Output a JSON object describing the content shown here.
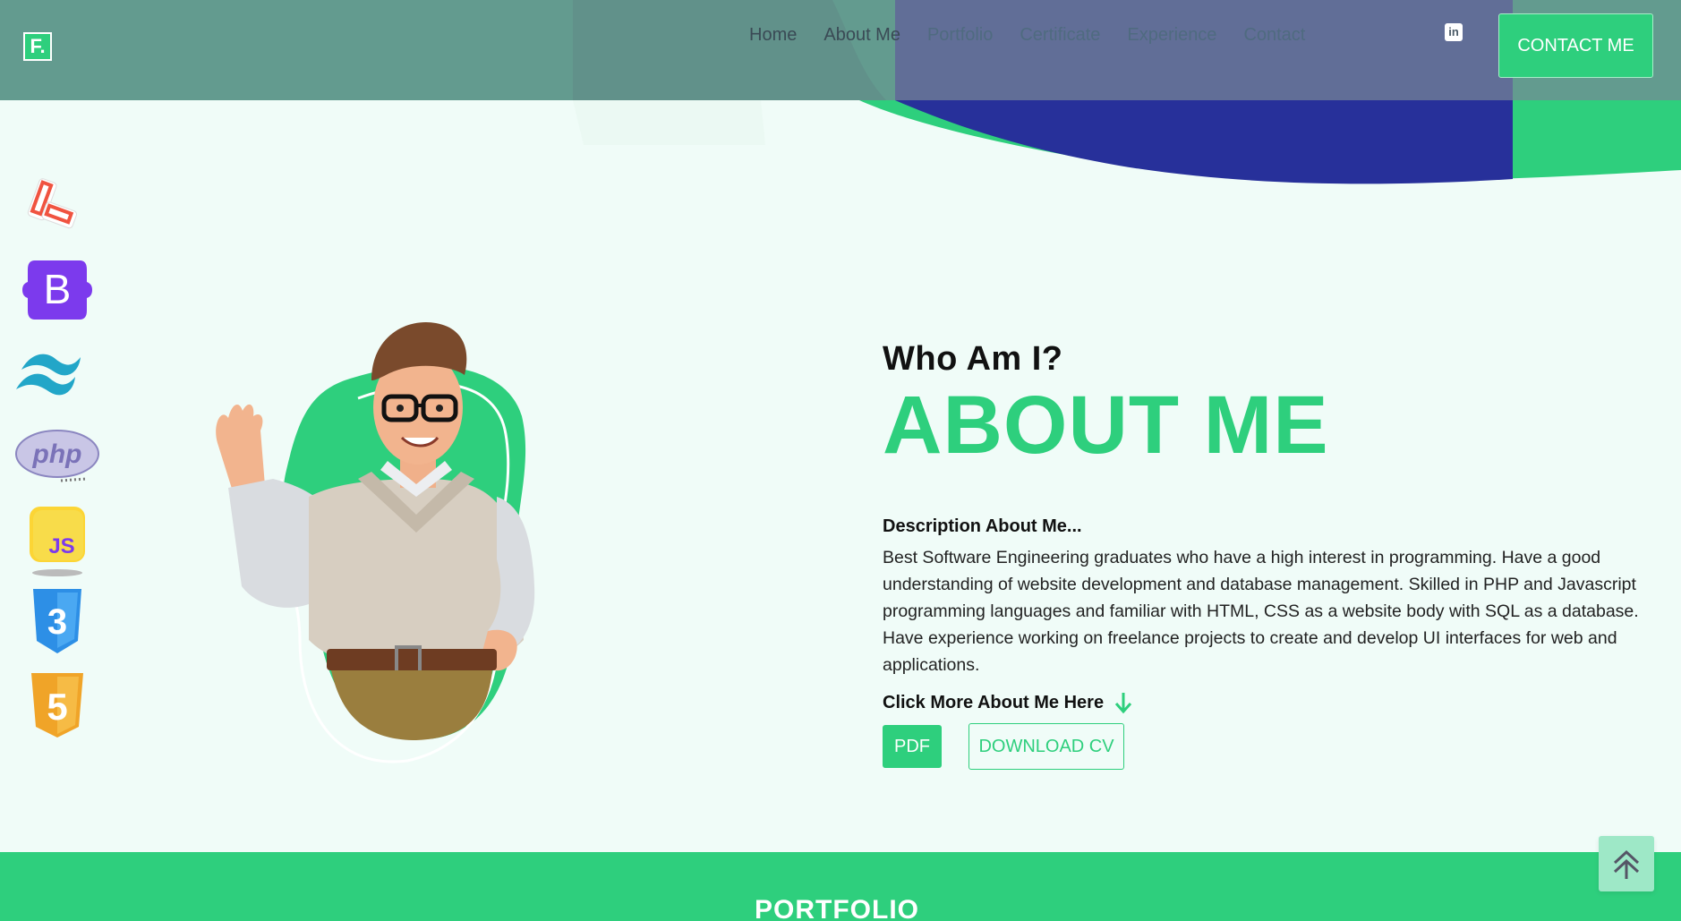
{
  "brand": {
    "logo_text": "F."
  },
  "nav": {
    "items": [
      {
        "label": "Home"
      },
      {
        "label": "About Me"
      },
      {
        "label": "Portfolio"
      },
      {
        "label": "Certificate"
      },
      {
        "label": "Experience"
      },
      {
        "label": "Contact"
      }
    ],
    "linkedin_text": "in",
    "contact_label": "CONTACT ME"
  },
  "tech_icons": [
    "laravel-icon",
    "bootstrap-icon",
    "tailwind-icon",
    "php-icon",
    "javascript-icon",
    "css3-icon",
    "html5-icon"
  ],
  "tech_text": {
    "bootstrap": "B",
    "php": "php",
    "js": "JS",
    "css": "3",
    "html": "5"
  },
  "about": {
    "subtitle": "Who Am I?",
    "title": "ABOUT ME",
    "desc_label": "Description About Me...",
    "description": "Best Software Engineering graduates who have a high interest in programming. Have a good understanding of website development and database management. Skilled in PHP and Javascript programming languages and familiar with HTML, CSS as a website body with SQL as a database. Have experience working on freelance projects to create and develop UI interfaces for web and applications.",
    "more_label": "Click More About Me Here",
    "pdf_label": "PDF",
    "cv_label": "DOWNLOAD CV"
  },
  "portfolio": {
    "title": "PORTFOLIO"
  },
  "colors": {
    "accent": "#2ecf7d",
    "background": "#f0fcf8",
    "hero_blue": "#27309a"
  }
}
